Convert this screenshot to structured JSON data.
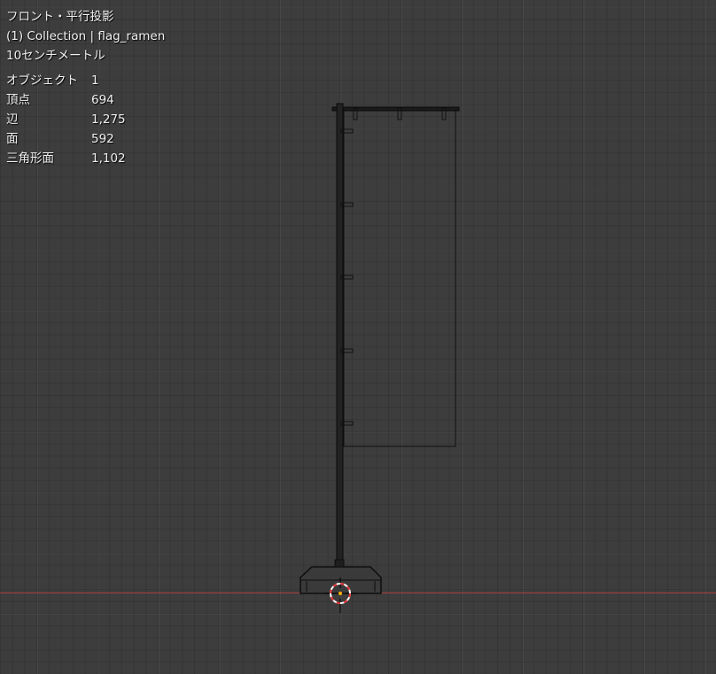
{
  "viewport": {
    "view_name": "フロント・平行投影",
    "collection_line": "(1) Collection | flag_ramen",
    "scale_label": "10センチメートル"
  },
  "stats": {
    "rows": [
      {
        "label": "オブジェクト",
        "value": "1"
      },
      {
        "label": "頂点",
        "value": "694"
      },
      {
        "label": "辺",
        "value": "1,275"
      },
      {
        "label": "面",
        "value": "592"
      },
      {
        "label": "三角形面",
        "value": "1,102"
      }
    ]
  },
  "colors": {
    "background": "#3d3d3d",
    "x_axis": "#a5403f",
    "wire": "#111111",
    "cursor_red": "#e03030"
  },
  "icons": [
    "3d-cursor-icon"
  ]
}
